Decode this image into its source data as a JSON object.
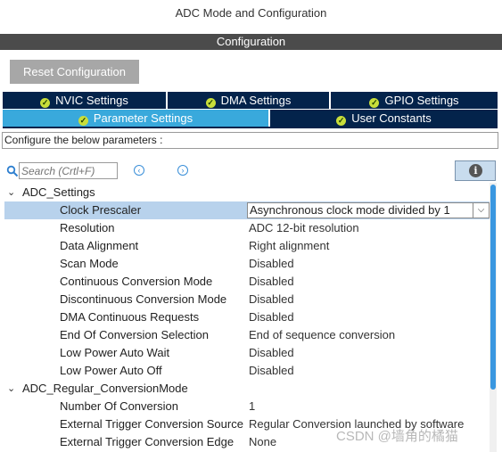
{
  "window_title": "ADC Mode and Configuration",
  "section_title": "Configuration",
  "reset_button": "Reset Configuration",
  "tabs": {
    "nvic": "NVIC Settings",
    "dma": "DMA Settings",
    "gpio": "GPIO Settings",
    "parameter": "Parameter Settings",
    "user_constants": "User Constants",
    "active": "Parameter Settings"
  },
  "configure_text": "Configure the below parameters :",
  "search": {
    "placeholder": "Search (Crtl+F)"
  },
  "groups": {
    "adc_settings": "ADC_Settings",
    "regular": "ADC_Regular_ConversionMode"
  },
  "params": [
    {
      "name": "Clock Prescaler",
      "value": "Asynchronous clock mode divided by 1"
    },
    {
      "name": "Resolution",
      "value": "ADC 12-bit resolution"
    },
    {
      "name": "Data Alignment",
      "value": "Right alignment"
    },
    {
      "name": "Scan Mode",
      "value": "Disabled"
    },
    {
      "name": "Continuous Conversion Mode",
      "value": "Disabled"
    },
    {
      "name": "Discontinuous Conversion Mode",
      "value": "Disabled"
    },
    {
      "name": "DMA Continuous Requests",
      "value": "Disabled"
    },
    {
      "name": "End Of Conversion Selection",
      "value": "End of sequence conversion"
    },
    {
      "name": "Low Power Auto Wait",
      "value": "Disabled"
    },
    {
      "name": "Low Power Auto Off",
      "value": "Disabled"
    }
  ],
  "regular_params": [
    {
      "name": "Number Of Conversion",
      "value": "1"
    },
    {
      "name": "External Trigger Conversion Source",
      "value": "Regular Conversion launched by software"
    },
    {
      "name": "External Trigger Conversion Edge",
      "value": "None"
    }
  ],
  "watermark": "CSDN @墙角的橘猫",
  "colors": {
    "tab_dark": "#03234b",
    "tab_active": "#39a9dc",
    "check_badge": "#c8de3a",
    "selected_row": "#b8d2ec",
    "scroll_thumb": "#3a97e0"
  }
}
